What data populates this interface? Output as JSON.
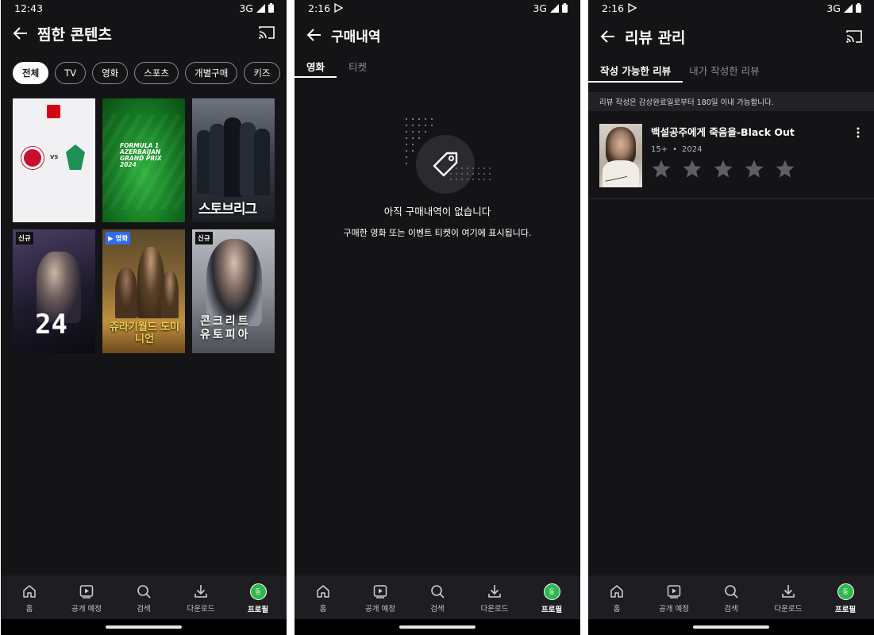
{
  "screens": [
    {
      "time": "12:43",
      "network": "3G",
      "title": "찜한 콘텐츠",
      "chips": [
        "전체",
        "TV",
        "영화",
        "스포츠",
        "개별구매",
        "키즈"
      ],
      "posters": [
        {
          "badge": "",
          "label": "VS"
        },
        {
          "badge": "",
          "label": "FORMULA 1 AZERBAIJAN GRAND PRIX 2024"
        },
        {
          "badge": "",
          "label": "스토브리그"
        },
        {
          "badge": "신규",
          "label": "24"
        },
        {
          "badge": "영화",
          "label": "쥬라기월드 도미니언"
        },
        {
          "badge": "신규",
          "label": "콘크리트 유토피아"
        }
      ]
    },
    {
      "time": "2:16",
      "network": "3G",
      "title": "구매내역",
      "tabs": [
        "영화",
        "티켓"
      ],
      "empty_title": "아직 구매내역이 없습니다",
      "empty_sub": "구매한 영화 또는 이벤트 티켓이 여기에 표시됩니다."
    },
    {
      "time": "2:16",
      "network": "3G",
      "title": "리뷰 관리",
      "tabs": [
        "작성 가능한 리뷰",
        "내가 작성한 리뷰"
      ],
      "notice": "리뷰 작성은 감상완료일로부터 180일 이내 가능합니다.",
      "review": {
        "title": "백설공주에게 죽음을-Black Out",
        "rating": "15+",
        "year": "2024"
      }
    }
  ],
  "nav": {
    "items": [
      "홈",
      "공개 예정",
      "검색",
      "다운로드",
      "프로필"
    ],
    "avatar_text": "동"
  },
  "colors": {
    "background": "#141417",
    "nav_background": "#1e1e22",
    "accent_green": "#2fb84f",
    "badge_blue": "#2f6cf2"
  }
}
